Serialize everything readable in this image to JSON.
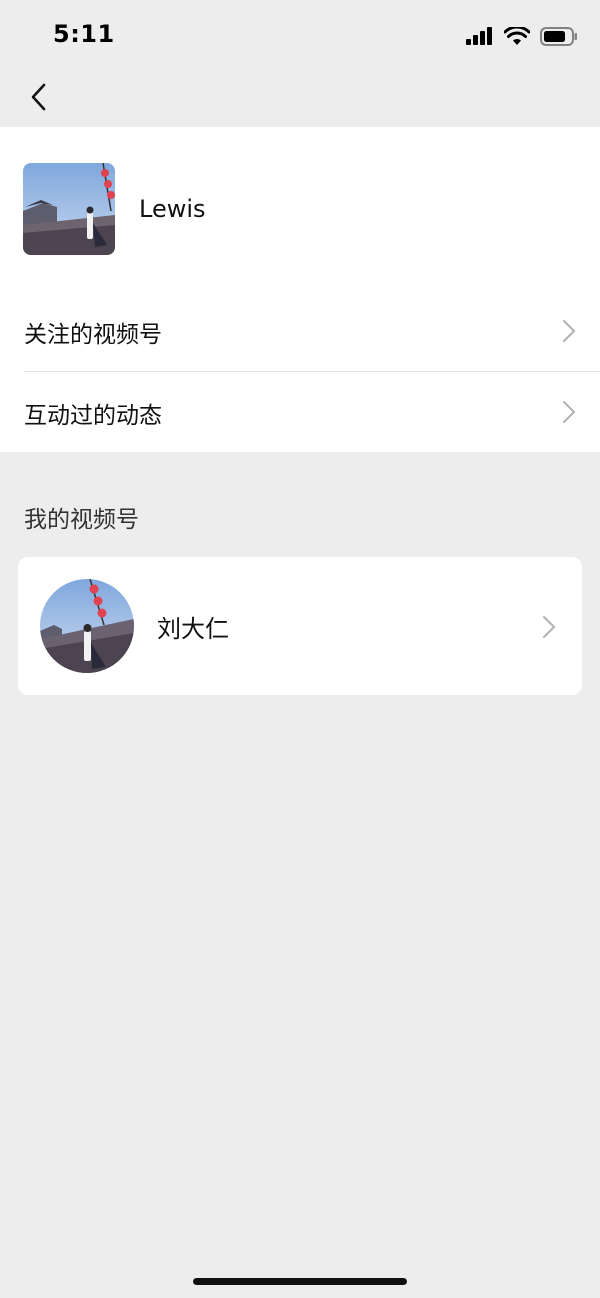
{
  "status_bar": {
    "time": "5:11",
    "icons": [
      "signal-icon",
      "wifi-icon",
      "battery-icon"
    ]
  },
  "nav": {
    "back_icon": "chevron-left-icon"
  },
  "profile": {
    "name": "Lewis",
    "avatar": "photo-avatar"
  },
  "menu": {
    "items": [
      {
        "label": "关注的视频号"
      },
      {
        "label": "互动过的动态"
      }
    ]
  },
  "my_channel": {
    "section_title": "我的视频号",
    "name": "刘大仁",
    "avatar": "photo-avatar-round"
  },
  "colors": {
    "background": "#ededed",
    "card": "#ffffff",
    "text": "#111111",
    "secondary_text": "#333333",
    "chevron": "#b2b2b2"
  }
}
